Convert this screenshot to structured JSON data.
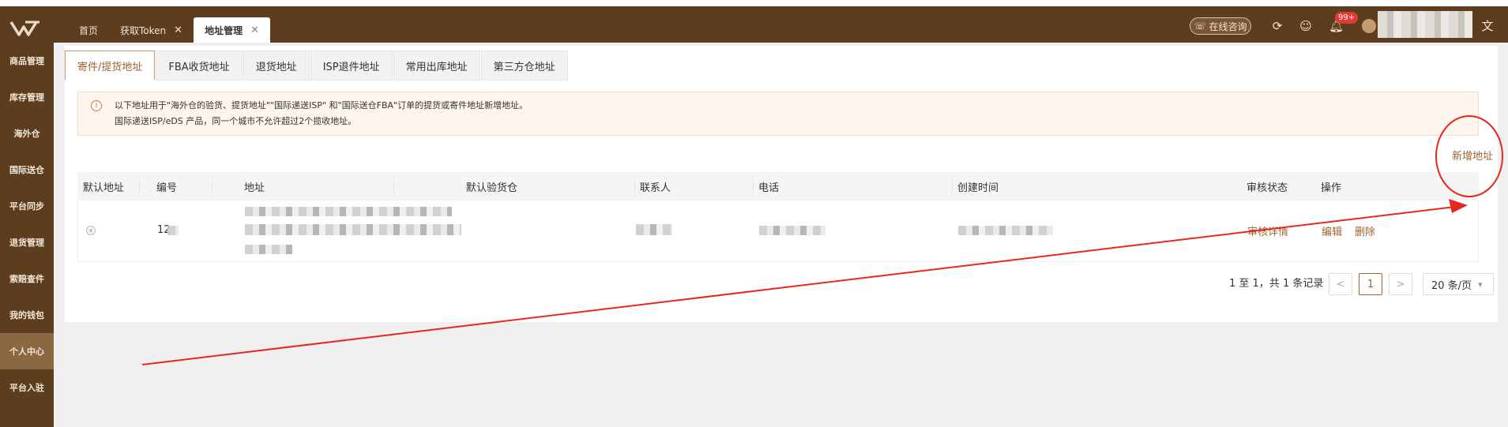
{
  "top_tabs": [
    {
      "label": "首页",
      "closable": false,
      "active": false
    },
    {
      "label": "获取Token",
      "closable": true,
      "active": false
    },
    {
      "label": "地址管理",
      "closable": true,
      "active": true
    }
  ],
  "topbar": {
    "consult_label": "在线咨询",
    "badge": "99+",
    "icons": [
      "refresh-icon",
      "smile-icon",
      "bell-icon",
      "translate-icon"
    ]
  },
  "sidebar": {
    "items": [
      {
        "label": "商品管理"
      },
      {
        "label": "库存管理"
      },
      {
        "label": "海外仓"
      },
      {
        "label": "国际送仓"
      },
      {
        "label": "平台同步"
      },
      {
        "label": "退货管理"
      },
      {
        "label": "索赔查件"
      },
      {
        "label": "我的钱包"
      },
      {
        "label": "个人中心",
        "active": true
      },
      {
        "label": "平台入驻"
      }
    ]
  },
  "sub_tabs": [
    {
      "label": "寄件/提货地址",
      "active": true
    },
    {
      "label": "FBA收货地址"
    },
    {
      "label": "退货地址"
    },
    {
      "label": "ISP退件地址"
    },
    {
      "label": "常用出库地址"
    },
    {
      "label": "第三方仓地址"
    }
  ],
  "notice": {
    "line1": "以下地址用于\"海外仓的验货、提货地址\"\"国际递送ISP\" 和\"国际送仓FBA\"订单的提货或寄件地址新增地址。",
    "line2": "国际递送ISP/eDS 产品，同一个城市不允许超过2个揽收地址。"
  },
  "add_address_label": "新增地址",
  "table": {
    "headers": [
      "默认地址",
      "编号",
      "地址",
      "默认验货仓",
      "联系人",
      "电话",
      "创建时间",
      "审核状态",
      "操作"
    ],
    "row": {
      "id_prefix": "12",
      "status_link": "审核详情",
      "edit_label": "编辑",
      "delete_label": "删除"
    }
  },
  "pagination": {
    "summary": "1 至 1，共 1 条记录",
    "prev": "<",
    "current_page": "1",
    "next": ">",
    "page_size": "20 条/页"
  },
  "colors": {
    "brand_brown": "#5c3d1e",
    "accent": "#a0622f",
    "annotation_red": "#e8281e"
  }
}
